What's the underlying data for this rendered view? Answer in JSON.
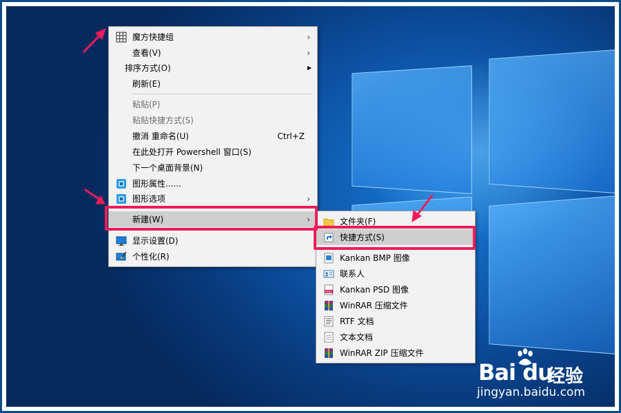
{
  "main_menu": {
    "items": [
      {
        "label": "魔方快捷组",
        "icon": "grid-icon",
        "has_submenu": true
      },
      {
        "label": "查看(V)",
        "has_submenu": true
      },
      {
        "label": "排序方式(O)",
        "has_submenu": true
      },
      {
        "label": "刷新(E)"
      },
      {
        "label": "粘贴(P)",
        "disabled": true
      },
      {
        "label": "粘贴快捷方式(S)",
        "disabled": true
      },
      {
        "label": "撤消 重命名(U)",
        "shortcut": "Ctrl+Z"
      },
      {
        "label": "在此处打开 Powershell 窗口(S)"
      },
      {
        "label": "下一个桌面背景(N)"
      },
      {
        "label": "图形属性......",
        "icon": "intel-graphics-icon"
      },
      {
        "label": "图形选项",
        "icon": "intel-graphics-icon",
        "has_submenu": true
      },
      {
        "label": "新建(W)",
        "has_submenu": true,
        "highlighted": true
      },
      {
        "label": "显示设置(D)",
        "icon": "display-icon"
      },
      {
        "label": "个性化(R)",
        "icon": "personalize-icon"
      }
    ]
  },
  "sub_menu": {
    "items": [
      {
        "label": "文件夹(F)",
        "icon": "folder-icon"
      },
      {
        "label": "快捷方式(S)",
        "icon": "shortcut-icon",
        "highlighted": true
      },
      {
        "label": "Kankan BMP 图像",
        "icon": "bmp-icon"
      },
      {
        "label": "联系人",
        "icon": "contact-icon"
      },
      {
        "label": "Kankan PSD 图像",
        "icon": "psd-icon"
      },
      {
        "label": "WinRAR 压缩文件",
        "icon": "winrar-icon"
      },
      {
        "label": "RTF 文档",
        "icon": "rtf-icon"
      },
      {
        "label": "文本文档",
        "icon": "text-document-icon"
      },
      {
        "label": "WinRAR ZIP 压缩文件",
        "icon": "winrar-zip-icon"
      }
    ]
  },
  "watermark": {
    "brand": "Bai  du",
    "brand_cn": "经验",
    "url": "jingyan.baidu.com"
  },
  "colors": {
    "highlight_border": "#ee1c5a",
    "desktop_blue": "#0d55a8"
  }
}
